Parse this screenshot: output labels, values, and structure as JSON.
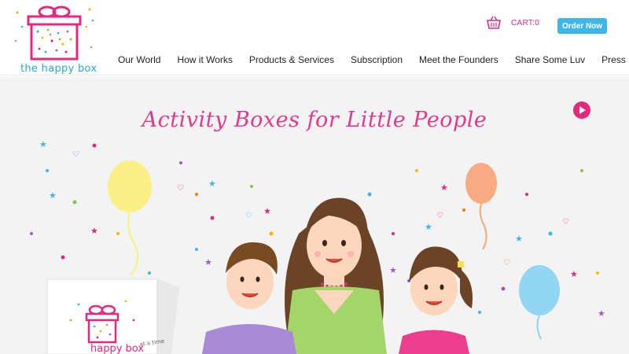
{
  "brand": {
    "name_prefix": "the ",
    "name_highlight": "happy",
    "name_suffix": " box"
  },
  "header": {
    "cart_label": "CART:0",
    "order_label": "Order Now",
    "cart_icon": "basket-icon"
  },
  "nav": {
    "items": [
      {
        "label": "Our World"
      },
      {
        "label": "How it Works"
      },
      {
        "label": "Products & Services"
      },
      {
        "label": "Subscription"
      },
      {
        "label": "Meet the Founders"
      },
      {
        "label": "Share Some Luv"
      },
      {
        "label": "Press"
      }
    ]
  },
  "hero": {
    "title": "Activity Boxes for Little People",
    "play_icon": "play-icon",
    "box_label": "happy box",
    "box_tagline": "at a time"
  },
  "colors": {
    "brand_pink": "#e4287d",
    "accent_blue": "#3fb6e8",
    "hero_bg": "#f3f3f3"
  }
}
